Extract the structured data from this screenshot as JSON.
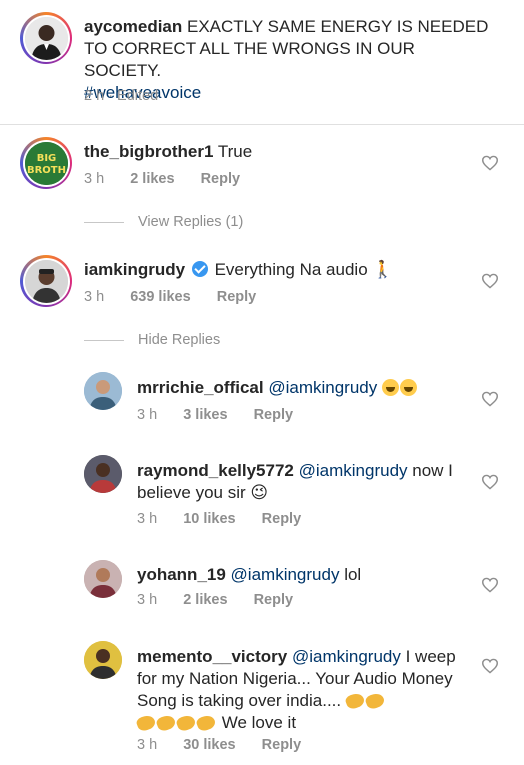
{
  "caption": {
    "username": "aycomedian",
    "text": "EXACTLY SAME ENERGY IS NEEDED TO CORRECT ALL THE WRONGS IN OUR SOCIETY.",
    "hashtag": "#wehaveavoice",
    "time": "2 h",
    "edited": "· Edited"
  },
  "comments": [
    {
      "username": "the_bigbrother1",
      "text": "True",
      "time": "3 h",
      "likes": "2 likes",
      "reply": "Reply",
      "toggle": "View Replies (1)"
    },
    {
      "username": "iamkingrudy",
      "text": "Everything Na audio",
      "emoji": "🚶",
      "time": "3 h",
      "likes": "639 likes",
      "reply": "Reply",
      "toggle": "Hide Replies"
    }
  ],
  "replies": [
    {
      "username": "mrrichie_offical",
      "mention": "@iamkingrudy",
      "text": "",
      "time": "3 h",
      "likes": "3 likes",
      "reply": "Reply"
    },
    {
      "username": "raymond_kelly5772",
      "mention": "@iamkingrudy",
      "text": "now I believe you sir",
      "emoji": "😉",
      "time": "3 h",
      "likes": "10 likes",
      "reply": "Reply"
    },
    {
      "username": "yohann_19",
      "mention": "@iamkingrudy",
      "text": "lol",
      "time": "3 h",
      "likes": "2 likes",
      "reply": "Reply"
    },
    {
      "username": "memento__victory",
      "mention": "@iamkingrudy",
      "text": "I weep for my Nation Nigeria... Your Audio Money Song is taking over india....",
      "text2": "We love it",
      "time": "3 h",
      "likes": "30 likes",
      "reply": "Reply"
    }
  ],
  "colors": {
    "text": "#262626",
    "muted": "#8e8e8e",
    "link": "#003569",
    "verified": "#3897f0"
  }
}
